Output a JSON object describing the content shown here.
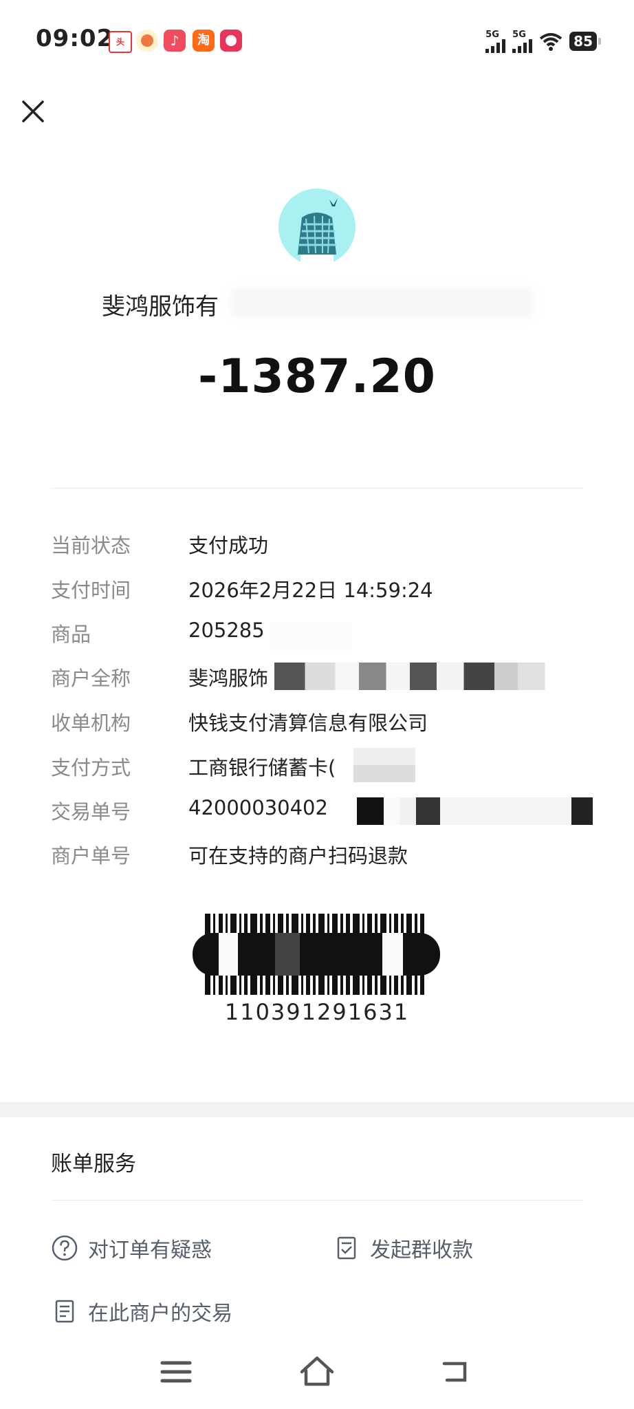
{
  "status_bar": {
    "time": "09:02",
    "network_1": "5G",
    "network_2": "5G",
    "battery": "85"
  },
  "header": {
    "close_icon": "close-icon"
  },
  "merchant": {
    "name_visible": "斐鸿服饰有"
  },
  "amount": "-1387.20",
  "details": {
    "rows": [
      {
        "label": "当前状态",
        "value": "支付成功"
      },
      {
        "label": "支付时间",
        "value": "2026年2月22日 14:59:24"
      },
      {
        "label": "商品",
        "value": "205285"
      },
      {
        "label": "商户全称",
        "value": "斐鸿服饰"
      },
      {
        "label": "收单机构",
        "value": "快钱支付清算信息有限公司"
      },
      {
        "label": "支付方式",
        "value": "工商银行储蓄卡("
      },
      {
        "label": "交易单号",
        "value": "42000030402"
      },
      {
        "label": "商户单号",
        "value": "可在支持的商户扫码退款"
      }
    ]
  },
  "barcode": {
    "number": "110391291631"
  },
  "bill_services": {
    "title": "账单服务",
    "items": [
      {
        "label": "对订单有疑惑",
        "icon": "question-circle-icon"
      },
      {
        "label": "发起群收款",
        "icon": "group-collect-icon"
      },
      {
        "label": "在此商户的交易",
        "icon": "document-list-icon"
      }
    ]
  },
  "nav": {
    "menu_icon": "menu-icon",
    "home_icon": "home-icon",
    "back_icon": "back-icon"
  },
  "colors": {
    "label_gray": "#8a8a8a",
    "service_text": "#555e6b",
    "avatar_bg": "#a9f0f2"
  }
}
